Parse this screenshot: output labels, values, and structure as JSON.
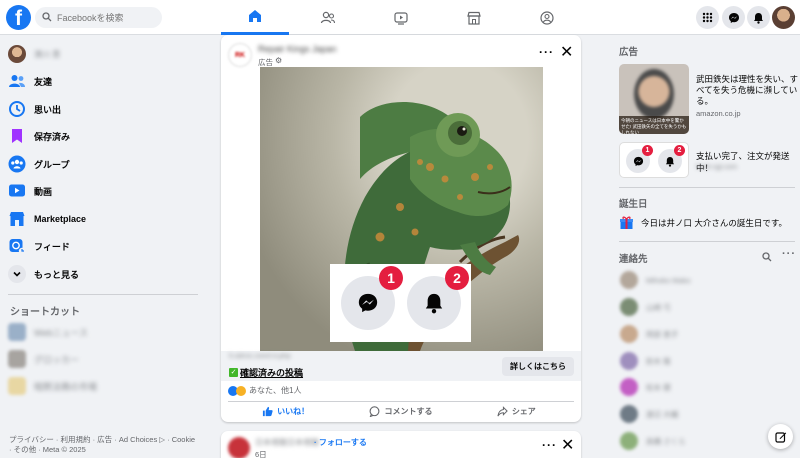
{
  "topbar": {
    "search_placeholder": "Facebookを検索",
    "nav_tabs": [
      "home",
      "friends",
      "watch",
      "marketplace",
      "groups"
    ],
    "accent": "#1877f2"
  },
  "sidebar": {
    "user_name": "濱川 豊",
    "items": [
      {
        "label": "友達",
        "icon": "friends-icon"
      },
      {
        "label": "思い出",
        "icon": "memories-icon"
      },
      {
        "label": "保存済み",
        "icon": "saved-icon"
      },
      {
        "label": "グループ",
        "icon": "groups-icon"
      },
      {
        "label": "動画",
        "icon": "video-icon"
      },
      {
        "label": "Marketplace",
        "icon": "marketplace-icon"
      },
      {
        "label": "フィード",
        "icon": "feed-icon"
      },
      {
        "label": "もっと見る",
        "icon": "chevron-down-icon"
      }
    ],
    "shortcuts_title": "ショートカット",
    "shortcuts": [
      "Webニュース",
      "グロッカー",
      "暗黙法務の市場"
    ],
    "footer": "プライバシー · 利用規約 · 広告 · Ad Choices ▷ · Cookie · その他 · Meta © 2025"
  },
  "post": {
    "page_name": "Repair Kings Japan",
    "sponsored": "広告",
    "link_domain": "fi.sdrcic.com/l.it.php",
    "verified_text": "確認済みの投稿",
    "cta": "詳しくはこちら",
    "reactions_text": "あなた、他1人",
    "actions": [
      "いいね！",
      "コメントする",
      "シェア"
    ],
    "badges": [
      "1",
      "2"
    ]
  },
  "post2": {
    "page_name": "日本視聴日本視聴",
    "follow": "フォローする",
    "time": "6日"
  },
  "right": {
    "ads_title": "広告",
    "ad1": {
      "headline": "武田鉄矢は理性を失い、すべてを失う危機に瀕している。",
      "domain": "amazon.co.jp",
      "thumb_caption": "今朝のニュースは日本中を驚かせた! 武田鉄矢の全てを失うかもしれない"
    },
    "ad2": {
      "headline": "支払い完了、注文が発送中！",
      "domain": "flash-sgl.com",
      "badges": [
        "1",
        "2"
      ]
    },
    "birthday_title": "誕生日",
    "birthday_text": "今日は井ノ口 大介さんの誕生日です。",
    "contacts_title": "連絡先",
    "contacts": [
      "Mihoko Mako",
      "山崎 弓",
      "岡部 恵子",
      "鈴木 隆",
      "松本 健",
      "渡辺 大輔",
      "高橋 さくら"
    ]
  }
}
